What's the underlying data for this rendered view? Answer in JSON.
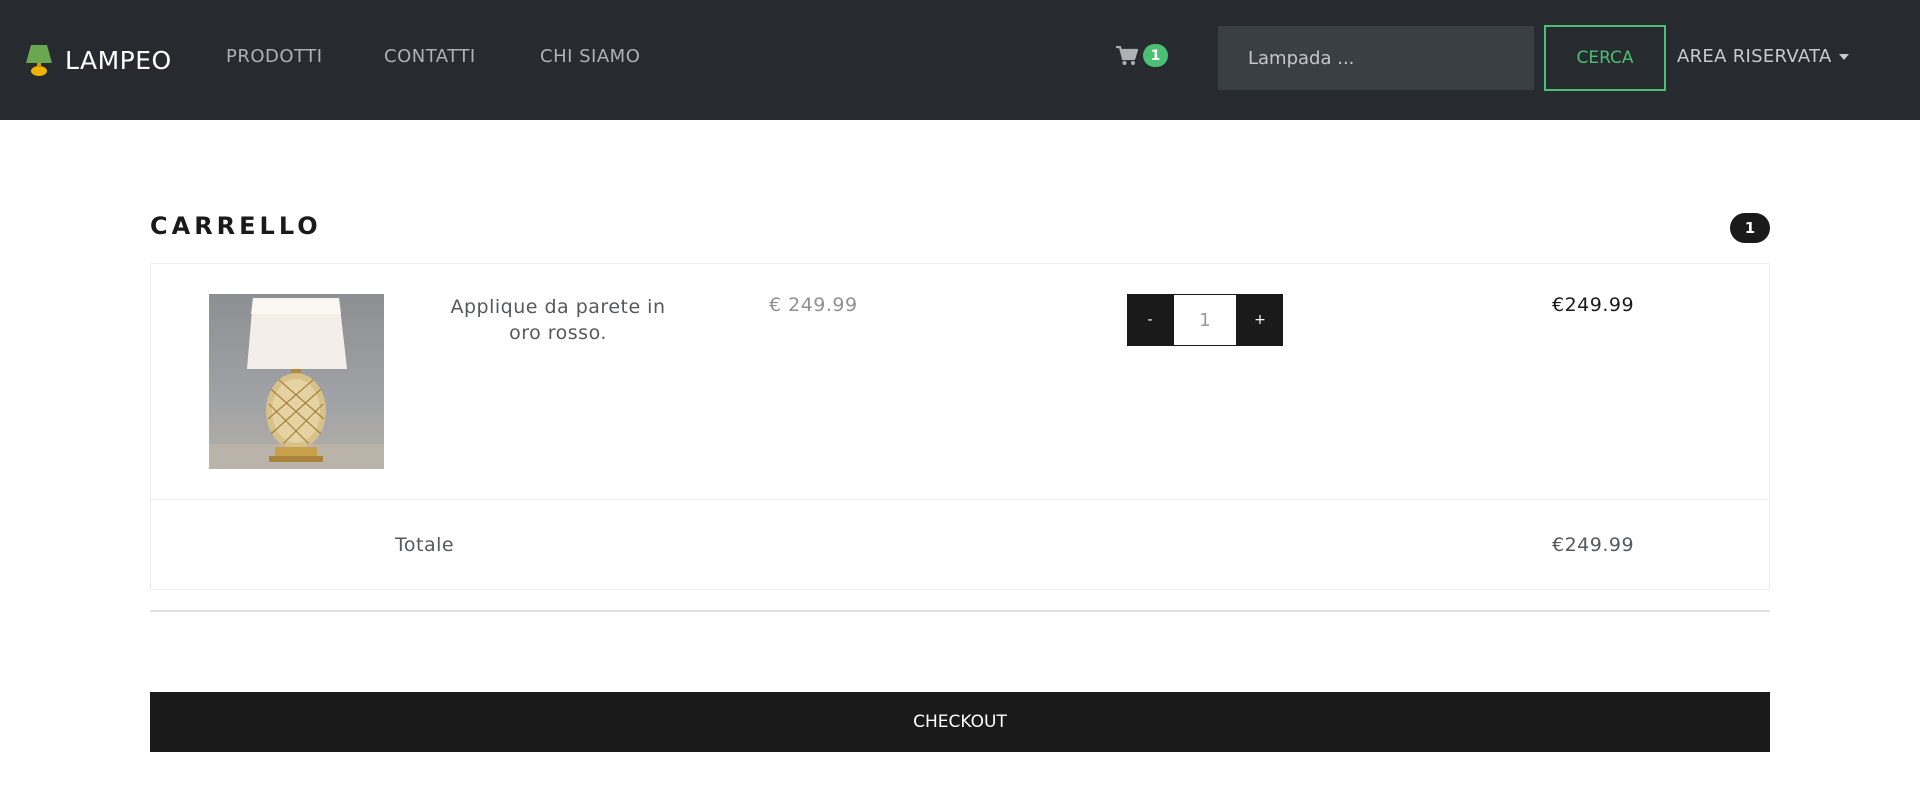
{
  "navbar": {
    "brand": "LAMPEO",
    "links": [
      "PRODOTTI",
      "CONTATTI",
      "CHI SIAMO"
    ],
    "cart_count": "1",
    "search_placeholder": "Lampada ...",
    "search_button": "CERCA",
    "account_menu": "AREA RISERVATA"
  },
  "cart": {
    "title": "CARRELLO",
    "item_count": "1",
    "items": [
      {
        "name": "Applique da parete in oro rosso.",
        "unit_price": "€ 249.99",
        "quantity": "1",
        "line_total": "€249.99"
      }
    ],
    "qty_minus": "-",
    "qty_plus": "+",
    "total_label": "Totale",
    "total_value": "€249.99",
    "checkout_button": "CHECKOUT"
  },
  "colors": {
    "navbar_bg": "#272b30",
    "accent_green": "#4bbf73",
    "dark": "#1a1a1a"
  },
  "icons": [
    "lamp-logo-icon",
    "shopping-cart-icon",
    "caret-down-icon"
  ]
}
